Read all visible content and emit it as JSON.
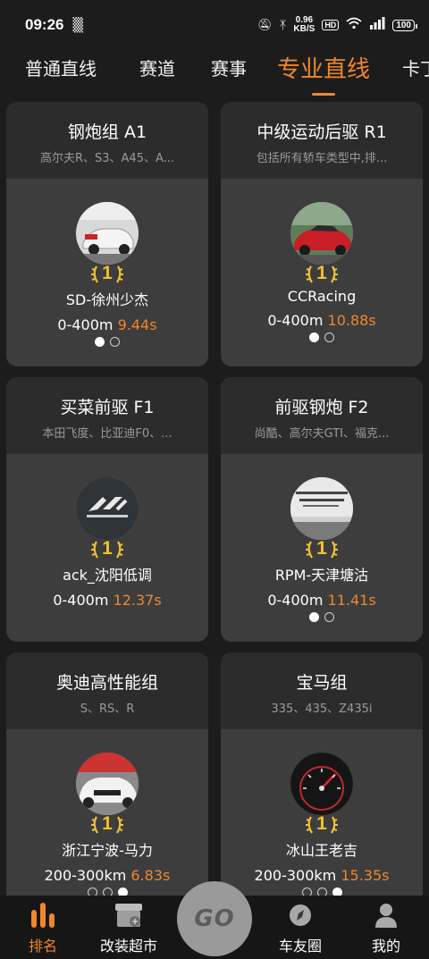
{
  "status_bar": {
    "time": "09:26",
    "speed_value": "0.96",
    "speed_unit": "KB/S",
    "hd": "HD",
    "battery": "100"
  },
  "tabs": [
    {
      "label": "普通直线",
      "active": false
    },
    {
      "label": "赛道",
      "active": false
    },
    {
      "label": "赛事",
      "active": false
    },
    {
      "label": "专业直线",
      "active": true
    },
    {
      "label": "卡丁",
      "active": false
    }
  ],
  "cards": [
    {
      "title": "钢炮组 A1",
      "subtitle": "高尔夫R、S3、A45、A...",
      "rank": "1",
      "driver": "SD-徐州少杰",
      "distance": "0-400m",
      "time": "9.44s",
      "avatar_icon": "white-audi-car-photo",
      "dots": [
        true,
        false
      ]
    },
    {
      "title": "中级运动后驱 R1",
      "subtitle": "包括所有轿车类型中,排...",
      "rank": "1",
      "driver": "CCRacing",
      "distance": "0-400m",
      "time": "10.88s",
      "avatar_icon": "red-car-photo",
      "dots": [
        true,
        false
      ]
    },
    {
      "title": "买菜前驱 F1",
      "subtitle": "本田飞度、比亚迪F0、...",
      "rank": "1",
      "driver": "ack_沈阳低调",
      "distance": "0-400m",
      "time": "12.37s",
      "avatar_icon": "ack-performance-logo",
      "dots": [
        false,
        false
      ]
    },
    {
      "title": "前驱钢炮 F2",
      "subtitle": "尚酷、高尔夫GTI、福克...",
      "rank": "1",
      "driver": "RPM-天津塘沽",
      "distance": "0-400m",
      "time": "11.41s",
      "avatar_icon": "car-window-sticker-photo",
      "dots": [
        true,
        false
      ]
    },
    {
      "title": "奥迪高性能组",
      "subtitle": "S、RS、R",
      "rank": "1",
      "driver": "浙江宁波-马力",
      "distance": "200-300km",
      "time": "6.83s",
      "avatar_icon": "white-audi-rs-photo",
      "dots": [
        false,
        false,
        true
      ]
    },
    {
      "title": "宝马组",
      "subtitle": "335、435、Z435i",
      "rank": "1",
      "driver": "冰山王老吉",
      "distance": "200-300km",
      "time": "15.35s",
      "avatar_icon": "speedometer-photo",
      "dots": [
        false,
        false,
        true
      ]
    }
  ],
  "bottom_nav": {
    "items": [
      {
        "label": "排名",
        "icon": "ranking-bars-icon",
        "active": true
      },
      {
        "label": "改装超市",
        "icon": "store-icon",
        "active": false
      },
      {
        "label": "车友圈",
        "icon": "compass-icon",
        "active": false
      },
      {
        "label": "我的",
        "icon": "person-icon",
        "active": false
      }
    ],
    "go_label": "GO"
  },
  "colors": {
    "accent": "#f0862a",
    "card": "#3d3d3d",
    "card_head": "#2c2c2c",
    "background": "#1c1c1c",
    "medal": "#f2c230"
  }
}
